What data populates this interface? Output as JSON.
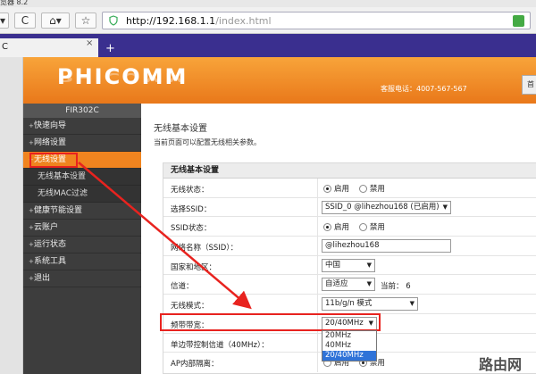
{
  "browser": {
    "window_title": "览器 8.2",
    "url_host": "http://192.168.1.1",
    "url_path": "/index.html",
    "tab_label": "C",
    "tab_close": "×",
    "new_tab": "+",
    "back_label": "▾",
    "refresh_label": "C",
    "home_label": "⌂▾",
    "star_label": "☆"
  },
  "header": {
    "logo": "PHICOMM",
    "hotline": "客服电话：4007-567-567",
    "button_label": "首"
  },
  "sidebar": {
    "model": "FIR302C",
    "items": [
      {
        "label": "快速向导"
      },
      {
        "label": "网络设置"
      },
      {
        "label": "无线设置"
      },
      {
        "label": "无线基本设置"
      },
      {
        "label": "无线MAC过滤"
      },
      {
        "label": "健康节能设置"
      },
      {
        "label": "云账户"
      },
      {
        "label": "运行状态"
      },
      {
        "label": "系统工具"
      },
      {
        "label": "退出"
      }
    ]
  },
  "main": {
    "title": "无线基本设置",
    "desc": "当前页面可以配置无线相关参数。",
    "panel_title": "无线基本设置",
    "rows": [
      {
        "label": "无线状态：",
        "options": [
          "启用",
          "禁用"
        ]
      },
      {
        "label": "选择SSID：",
        "value": "SSID_0 @lihezhou168 (已启用)"
      },
      {
        "label": "SSID状态：",
        "options": [
          "启用",
          "禁用"
        ]
      },
      {
        "label": "网络名称（SSID）：",
        "value": "@lihezhou168"
      },
      {
        "label": "国家和地区：",
        "value": "中国"
      },
      {
        "label": "信道：",
        "value": "自适应",
        "extra": "当前：  6"
      },
      {
        "label": "无线模式：",
        "value": "11b/g/n 模式"
      },
      {
        "label": "频带带宽：",
        "value": "20/40MHz"
      },
      {
        "label": "单边带控制信道（40MHz）：",
        "value": ""
      },
      {
        "label": "AP内部隔离：",
        "options": [
          "启用",
          "禁用"
        ]
      }
    ],
    "bandwidth_options": [
      "20MHz",
      "40MHz",
      "20/40MHz"
    ]
  },
  "watermark": "路由网",
  "colors": {
    "header_orange": "#f0841f",
    "sidebar_bg": "#3d3d3d",
    "highlight_red": "#e8231f",
    "selected_blue": "#2f73d8",
    "tabbar_purple": "#3a2f8f"
  }
}
